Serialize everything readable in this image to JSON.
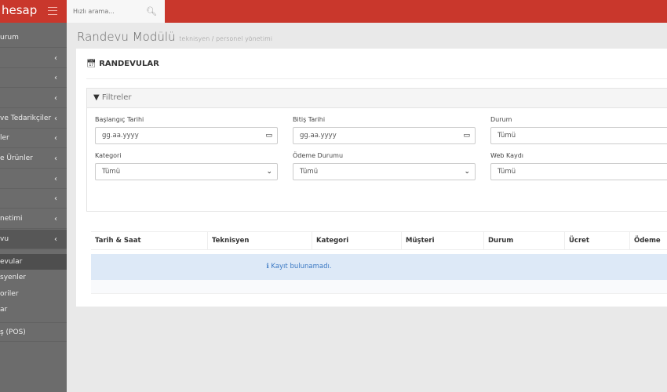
{
  "brand": {
    "name": "hesap",
    "accent": "#c9372c"
  },
  "search": {
    "placeholder": "Hızlı arama..."
  },
  "sidebar": {
    "items": [
      {
        "label": "urum"
      },
      {
        "label": ""
      },
      {
        "label": ""
      },
      {
        "label": ""
      },
      {
        "label": "ve Tedarikçiler"
      },
      {
        "label": "ler"
      },
      {
        "label": "e Ürünler"
      },
      {
        "label": ""
      },
      {
        "label": ""
      },
      {
        "label": "netimi"
      },
      {
        "label": "vu"
      }
    ],
    "subitems": [
      {
        "label": "evular"
      },
      {
        "label": "syenler"
      },
      {
        "label": "oriler"
      },
      {
        "label": "ar"
      }
    ],
    "extra": {
      "label": "ş (POS)"
    }
  },
  "page": {
    "title": "Randevu Modülü",
    "subtitle": "teknisyen / personel yönetimi",
    "panel_title": "RANDEVULAR"
  },
  "filters": {
    "heading": "Filtreler",
    "fields": [
      {
        "label": "Başlangıç Tarihi",
        "value": "gg.aa.yyyy"
      },
      {
        "label": "Bitiş Tarihi",
        "value": "gg.aa.yyyy"
      },
      {
        "label": "Durum",
        "value": "Tümü"
      },
      {
        "label": "Kategori",
        "value": "Tümü"
      },
      {
        "label": "Ödeme Durumu",
        "value": "Tümü"
      },
      {
        "label": "Web Kaydı",
        "value": "Tümü"
      }
    ]
  },
  "table": {
    "columns": [
      "Tarih & Saat",
      "Teknisyen",
      "Kategori",
      "Müşteri",
      "Durum",
      "Ücret",
      "Ödeme"
    ],
    "empty": "Kayıt bulunamadı."
  }
}
